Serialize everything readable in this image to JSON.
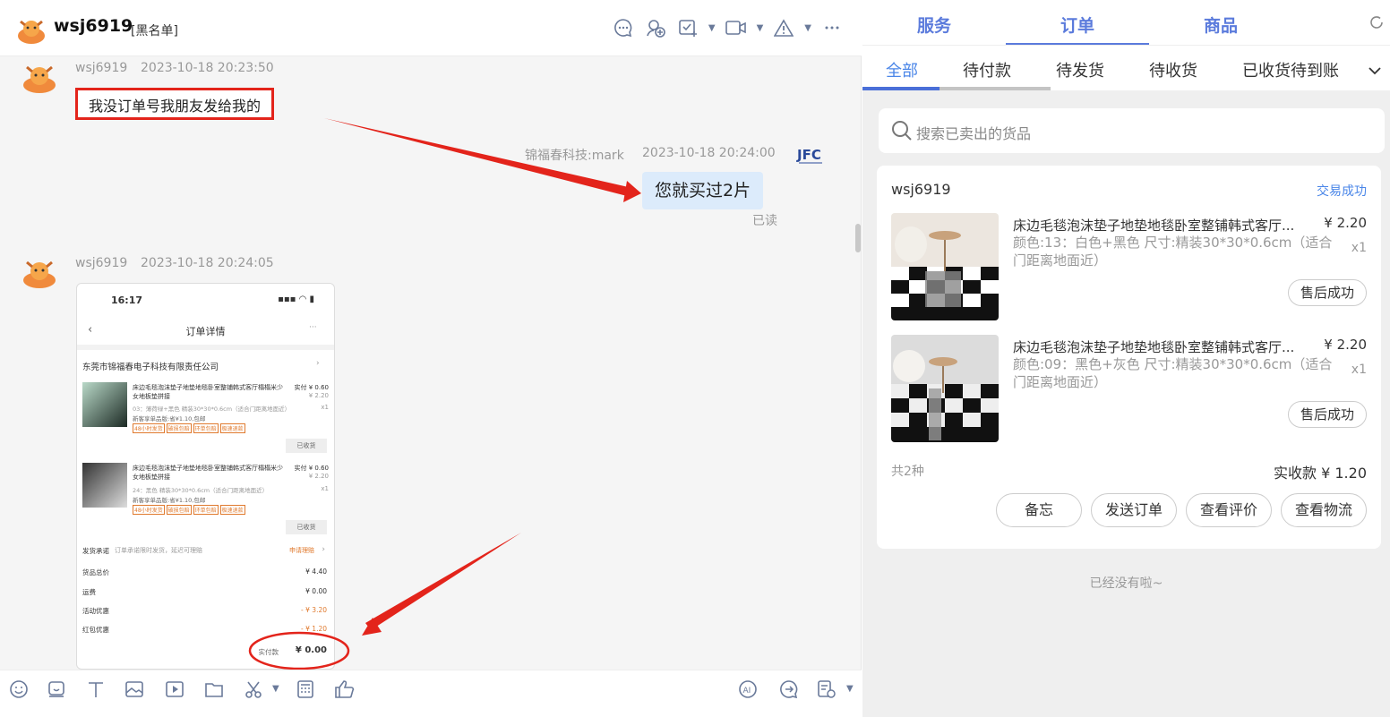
{
  "chat": {
    "header": {
      "name": "wsj6919",
      "tag": "[黑名单]"
    },
    "messages": [
      {
        "sender": "wsj6919",
        "time": "2023-10-18 20:23:50",
        "text": "我没订单号我朋友发给我的"
      },
      {
        "sender": "锦福春科技:mark",
        "time": "2023-10-18 20:24:00",
        "text": "您就买过2片",
        "status": "已读"
      },
      {
        "sender": "wsj6919",
        "time": "2023-10-18 20:24:05"
      }
    ],
    "screenshot": {
      "time": "16:17",
      "title": "订单详情",
      "shop": "东莞市锦福春电子科技有限责任公司",
      "items": [
        {
          "title": "床边毛毯泡沫垫子地垫地毯卧室整铺韩式客厅榻榻米少女地板垫拼接",
          "paid": "实付 ¥ 0.60",
          "price": "¥ 2.20",
          "spec": "03：薄荷绿+黑色 精装30*30*0.6cm（适合门距离地面近）",
          "qty": "x1",
          "note": "新客享单品版:省¥1.10,包邮",
          "tags": [
            "48小时发货",
            "破损包赔",
            "环单包赔",
            "极速退款"
          ],
          "state": "已收货"
        },
        {
          "title": "床边毛毯泡沫垫子地垫地毯卧室整铺韩式客厅榻榻米少女地板垫拼接",
          "paid": "实付 ¥ 0.60",
          "price": "¥ 2.20",
          "spec": "24：黑色 精装30*30*0.6cm（适合门距离地面近）",
          "qty": "x1",
          "note": "新客享单品版:省¥1.10,包邮",
          "tags": [
            "48小时发货",
            "破损包赔",
            "环单包赔",
            "极速退款"
          ],
          "state": "已收货"
        }
      ],
      "promise_label": "发货承诺",
      "promise_text": "订单承诺限时发货，延迟可理赔",
      "promise_action": "申请理赔",
      "fees": [
        {
          "label": "货品总价",
          "value": "¥ 4.40"
        },
        {
          "label": "运费",
          "value": "¥ 0.00"
        },
        {
          "label": "活动优惠",
          "value": "- ¥ 3.20"
        },
        {
          "label": "红包优惠",
          "value": "- ¥ 1.20"
        }
      ],
      "paid_label": "实付款",
      "paid_value": "¥ 0.00"
    }
  },
  "panel": {
    "tabs": [
      "服务",
      "订单",
      "商品"
    ],
    "subtabs": [
      "全部",
      "待付款",
      "待发货",
      "待收货",
      "已收货待到账"
    ],
    "search_placeholder": "搜索已卖出的货品",
    "order": {
      "buyer": "wsj6919",
      "status": "交易成功",
      "items": [
        {
          "title": "床边毛毯泡沫垫子地垫地毯卧室整铺韩式客厅...",
          "price": "¥ 2.20",
          "spec": "颜色:13：白色+黑色 尺寸:精装30*30*0.6cm（适合门距离地面近）",
          "qty": "x1",
          "after_sale": "售后成功"
        },
        {
          "title": "床边毛毯泡沫垫子地垫地毯卧室整铺韩式客厅...",
          "price": "¥ 2.20",
          "spec": "颜色:09：黑色+灰色 尺寸:精装30*30*0.6cm（适合门距离地面近）",
          "qty": "x1",
          "after_sale": "售后成功"
        }
      ],
      "count": "共2种",
      "total_label": "实收款",
      "total_value": "¥ 1.20",
      "actions": [
        "备忘",
        "发送订单",
        "查看评价",
        "查看物流"
      ]
    },
    "no_more": "已经没有啦~"
  },
  "colors": {
    "accent": "#4a86e8",
    "annotation": "#e3241b"
  }
}
